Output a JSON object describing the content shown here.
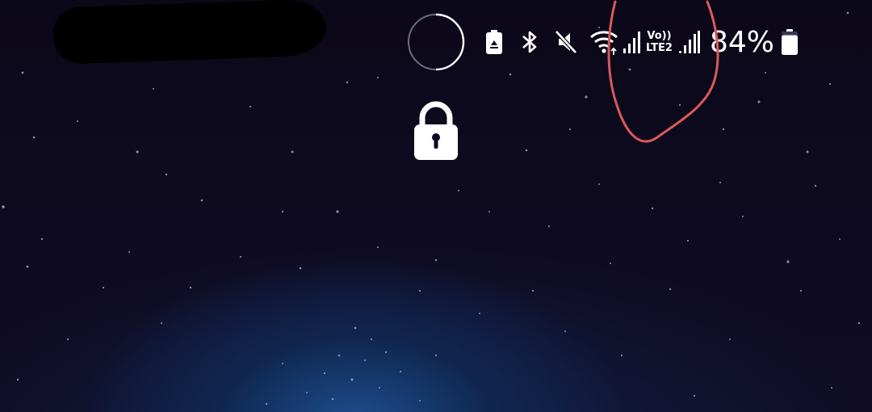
{
  "status_bar": {
    "icons": [
      "battery-saver-icon",
      "bluetooth-icon",
      "mute-icon",
      "wifi-icon",
      "signal-strength-sim1-icon",
      "volte-lte2-icon",
      "signal-strength-sim2-icon",
      "battery-icon"
    ],
    "volte_top": "Vo))",
    "volte_bottom": "LTE2",
    "battery_percent": "84%",
    "battery_level": 0.84
  },
  "lock_screen": {
    "lock_icon": "padlock-icon",
    "spinner_icon": "loading-ring-icon"
  },
  "colors": {
    "background": "#0d0a1c",
    "icon": "#ffffff",
    "annotation": "#d9595a",
    "redaction": "#000000"
  }
}
